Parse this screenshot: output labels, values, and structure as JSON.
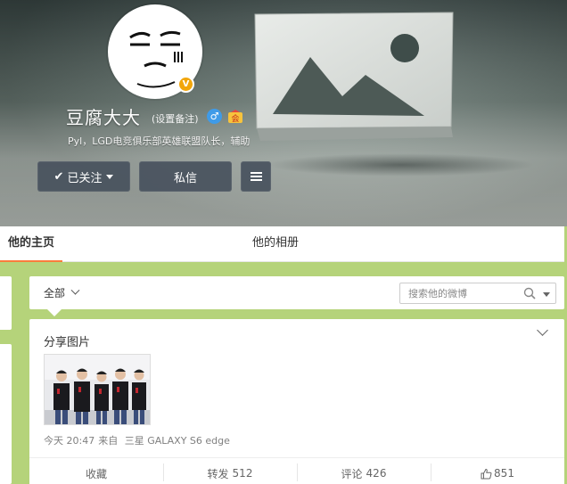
{
  "profile": {
    "username": "豆腐大大",
    "remark_link": "(设置备注)",
    "gender_icon": "male-icon",
    "bio": "Pyl，LGD电竞俱乐部英雄联盟队长，辅助",
    "verified_badge": "V"
  },
  "buttons": {
    "follow": "已关注",
    "message": "私信",
    "menu_icon": "hamburger-menu-icon"
  },
  "tabs": [
    {
      "label": "他的主页",
      "active": true
    },
    {
      "label": "他的相册",
      "active": false
    }
  ],
  "filter": {
    "all_label": "全部",
    "search_placeholder": "搜索他的微博"
  },
  "post": {
    "title": "分享图片",
    "time": "今天 20:47",
    "source_prefix": "来自",
    "source": "三星 GALAXY S6 edge",
    "actions": {
      "favorite": "收藏",
      "repost_label": "转发",
      "repost_count": "512",
      "comment_label": "评论",
      "comment_count": "426",
      "like_count": "851"
    }
  },
  "colors": {
    "page_bg": "#b5d37a",
    "active_tab_underline": "#fa7d3c",
    "verified_badge": "#f2a60b",
    "gender_badge": "#3f9be8"
  }
}
